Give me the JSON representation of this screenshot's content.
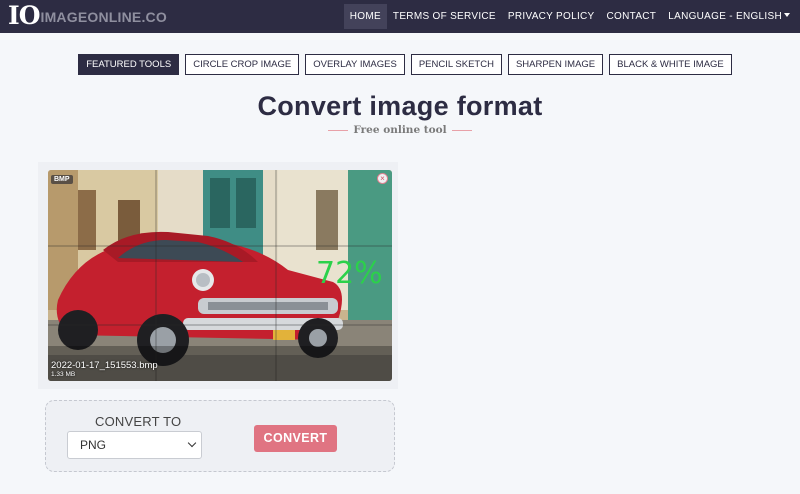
{
  "brand": {
    "mark": "IO",
    "name": "IMAGEONLINE.CO"
  },
  "nav": {
    "items": [
      {
        "label": "HOME",
        "active": true
      },
      {
        "label": "TERMS OF SERVICE"
      },
      {
        "label": "PRIVACY POLICY"
      },
      {
        "label": "CONTACT"
      },
      {
        "label": "LANGUAGE - ENGLISH"
      }
    ],
    "language_icon": "caret-down-icon"
  },
  "tools": [
    {
      "label": "FEATURED TOOLS",
      "active": true
    },
    {
      "label": "CIRCLE CROP IMAGE"
    },
    {
      "label": "OVERLAY IMAGES"
    },
    {
      "label": "PENCIL SKETCH"
    },
    {
      "label": "SHARPEN IMAGE"
    },
    {
      "label": "BLACK & WHITE IMAGE"
    }
  ],
  "page": {
    "title": "Convert image format",
    "subtitle": "Free online tool"
  },
  "upload": {
    "format_badge": "BMP",
    "remove_icon": "close-icon",
    "remove_symbol": "×",
    "progress": "72%",
    "progress_value": 0.72,
    "file_name": "2022-01-17_151553.bmp",
    "file_size": "1.33 MB"
  },
  "convert": {
    "label": "CONVERT TO",
    "selected_format": "PNG",
    "button_label": "CONVERT"
  },
  "colors": {
    "navbar": "#2d2c43",
    "accent": "#e07482",
    "progress": "#2bd14a"
  }
}
